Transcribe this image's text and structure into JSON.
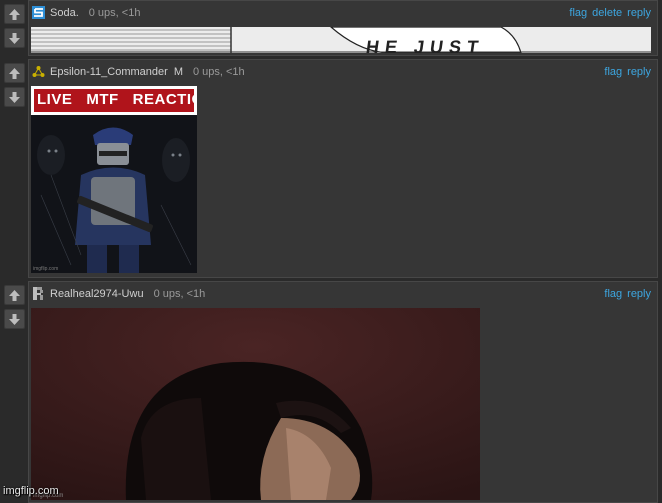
{
  "comments": [
    {
      "username": "Soda.",
      "meta": "0 ups, <1h",
      "actions": [
        "flag",
        "delete",
        "reply"
      ],
      "image_text": "HE JUST"
    },
    {
      "username": "Epsilon-11_Commander",
      "badge": "M",
      "meta": "0 ups, <1h",
      "actions": [
        "flag",
        "reply"
      ],
      "image_banner": "LIVE   MTF   REACTION",
      "image_credit": "imgflip.com"
    },
    {
      "username": "Realheal2974-Uwu",
      "meta": "0 ups, <1h",
      "actions": [
        "flag",
        "reply"
      ],
      "image_credit": "imgflip.com"
    }
  ],
  "watermark": "imgflip.com",
  "icons": {
    "upvote": "arrow-up-icon",
    "downvote": "arrow-down-icon",
    "avatar_1": "s-logo-icon",
    "avatar_2": "triangle-icon",
    "avatar_3": "r-logo-icon"
  },
  "colors": {
    "page_bg": "#2a2a2a",
    "comment_bg": "#363636",
    "link": "#3da6e0",
    "banner_red": "#b0141b"
  }
}
